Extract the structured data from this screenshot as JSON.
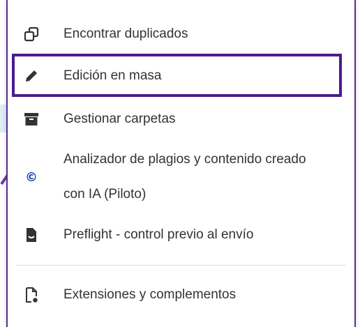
{
  "menu": {
    "items": [
      {
        "label": "Encontrar duplicados",
        "icon": "duplicate-icon"
      },
      {
        "label": "Edición en masa",
        "icon": "pencil-icon"
      },
      {
        "label": "Gestionar carpetas",
        "icon": "archive-box-icon"
      },
      {
        "label_line1": "Analizador de plagios y contenido creado",
        "label_line2": "con IA (Piloto)",
        "icon": "copyright-icon"
      },
      {
        "label": "Preflight - control previo al envío",
        "icon": "document-check-icon"
      },
      {
        "label": "Extensiones y complementos",
        "icon": "extension-file-icon"
      }
    ],
    "highlight_color": "#4d1a8c",
    "copyright_symbol": "©"
  }
}
